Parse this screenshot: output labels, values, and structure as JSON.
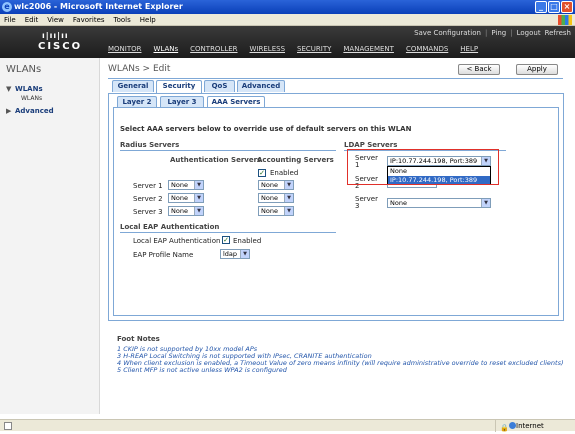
{
  "window": {
    "title": "wlc2006 - Microsoft Internet Explorer"
  },
  "menubar": [
    "File",
    "Edit",
    "View",
    "Favorites",
    "Tools",
    "Help"
  ],
  "header": {
    "brand": "CISCO",
    "toplinks": [
      "Save Configuration",
      "Ping",
      "Logout",
      "Refresh"
    ],
    "nav": [
      "MONITOR",
      "WLANs",
      "CONTROLLER",
      "WIRELESS",
      "SECURITY",
      "MANAGEMENT",
      "COMMANDS",
      "HELP"
    ],
    "active_nav": "WLANs"
  },
  "sidebar": {
    "title": "WLANs",
    "wlans_label": "WLANs",
    "wlans_sub": "WLANs",
    "advanced_label": "Advanced"
  },
  "page": {
    "breadcrumb": "WLANs > Edit",
    "back_button": "< Back",
    "apply_button": "Apply"
  },
  "tabs": [
    "General",
    "Security",
    "QoS",
    "Advanced"
  ],
  "active_tab": "Security",
  "subtabs": [
    "Layer 2",
    "Layer 3",
    "AAA Servers"
  ],
  "active_subtab": "AAA Servers",
  "aaa": {
    "intro": "Select AAA servers below to override use of default servers on this WLAN",
    "radius_title": "Radius Servers",
    "auth_col": "Authentication Servers",
    "acct_col": "Accounting Servers",
    "enabled_label": "Enabled",
    "enabled_checked": true,
    "radius_rows": [
      {
        "label": "Server 1",
        "auth": "None",
        "acct": "None"
      },
      {
        "label": "Server 2",
        "auth": "None",
        "acct": "None"
      },
      {
        "label": "Server 3",
        "auth": "None",
        "acct": "None"
      }
    ],
    "ldap_title": "LDAP Servers",
    "ldap_rows": [
      {
        "label_line1": "Server",
        "label_line2": "1",
        "value": "IP:10.77.244.198, Port:389"
      },
      {
        "label_line1": "Server",
        "label_line2": "2",
        "value": "None"
      },
      {
        "label_line1": "Server",
        "label_line2": "3",
        "value": "None"
      }
    ],
    "ldap_dropdown_options": [
      "None",
      "IP:10.77.244.198, Port:389"
    ],
    "ldap_dropdown_selected": "IP:10.77.244.198, Port:389",
    "local_eap_title": "Local EAP Authentication",
    "local_eap_label": "Local EAP Authentication",
    "local_eap_enabled_label": "Enabled",
    "local_eap_checked": true,
    "eap_profile_label": "EAP Profile Name",
    "eap_profile_value": "ldap"
  },
  "footnotes": {
    "title": "Foot Notes",
    "lines": [
      "1 CKIP is not supported by 10xx model APs",
      "3 H-REAP Local Switching is not supported with IPsec, CRANITE authentication",
      "4 When client exclusion is enabled, a Timeout Value of zero means infinity (will require administrative override to reset excluded clients)",
      "5 Client MFP is not active unless WPA2 is configured"
    ]
  },
  "statusbar": {
    "zone": "Internet"
  }
}
